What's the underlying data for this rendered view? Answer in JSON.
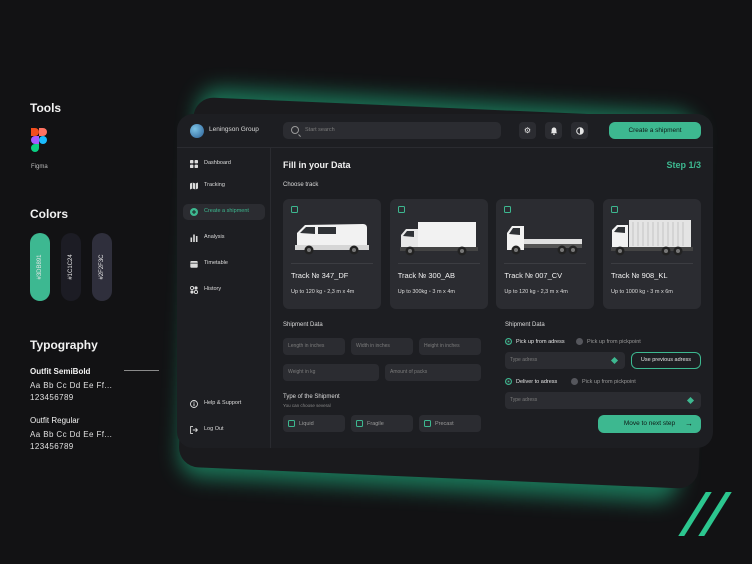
{
  "presentation": {
    "tools_title": "Tools",
    "tool_name": "Figma",
    "colors_title": "Colors",
    "swatches": [
      {
        "hex": "#3DB891",
        "label": "#3DB891"
      },
      {
        "hex": "#1C1C24",
        "label": "#1C1C24"
      },
      {
        "hex": "#2F2F3C",
        "label": "#2F2F3C"
      }
    ],
    "typography_title": "Typography",
    "font1": {
      "name": "Outfit SemiBold",
      "sample": "Aa Bb Cc Dd Ee Ff...",
      "digits": "123456789"
    },
    "font2": {
      "name": "Outfit Regular",
      "sample": "Aa Bb Cc Dd Ee Ff...",
      "digits": "123456789"
    }
  },
  "app": {
    "company": "Leningson Group",
    "search_placeholder": "Start search",
    "top_icons": [
      "gear-icon",
      "bell-icon",
      "contrast-icon"
    ],
    "create_button": "Create a shipment",
    "accent": "#3DB890"
  },
  "sidebar": {
    "items": [
      {
        "label": "Dashboard",
        "icon": "grid-icon",
        "active": false
      },
      {
        "label": "Tracking",
        "icon": "map-icon",
        "active": false
      },
      {
        "label": "Create a shipment",
        "icon": "plus-circle-icon",
        "active": true
      },
      {
        "label": "Analysis",
        "icon": "bar-chart-icon",
        "active": false
      },
      {
        "label": "Timetable",
        "icon": "calendar-icon",
        "active": false
      },
      {
        "label": "History",
        "icon": "history-icon",
        "active": false
      }
    ],
    "help": "Help & Support",
    "logout": "Log Out"
  },
  "form": {
    "title": "Fill in your Data",
    "step": "Step 1/3",
    "choose_track": "Choose track",
    "tracks": [
      {
        "name": "Track № 347_DF",
        "weight": "Up to 120 kg",
        "dims": "2,3 m x 4m"
      },
      {
        "name": "Track № 300_AB",
        "weight": "Up to 300kg",
        "dims": "3 m x 4m"
      },
      {
        "name": "Track № 007_CV",
        "weight": "Up to 120 kg",
        "dims": "2,3 m x 4m"
      },
      {
        "name": "Track № 908_KL",
        "weight": "Up to 1000 kg",
        "dims": "3 m x 6m"
      }
    ],
    "shipment_left": {
      "title": "Shipment Data",
      "length": "Length in inches",
      "width": "Width in inches",
      "height": "Height in inches",
      "weight": "Weight in kg",
      "packs": "Amount of packs"
    },
    "type_title": "Type of the Shipment",
    "type_hint": "You can choose several",
    "types": [
      "Liquid",
      "Fragile",
      "Precast"
    ],
    "shipment_right": {
      "title": "Shipment Data",
      "pickup_address": "Pick up from adress",
      "pickup_point": "Pick up from pickpoint",
      "address_placeholder": "Type adress",
      "previous_button": "Use previous adress",
      "deliver_address": "Deliver to adress",
      "deliver_point": "Pick up from pickpoint",
      "address_placeholder_2": "Type adress",
      "next_button": "Move to next step"
    }
  }
}
